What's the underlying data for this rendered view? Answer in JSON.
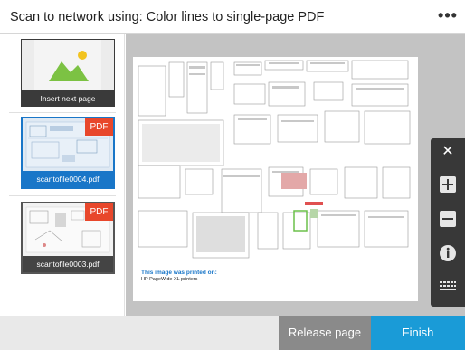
{
  "header": {
    "title": "Scan to network using: Color lines to single-page PDF",
    "more_icon": "more-dots-icon"
  },
  "sidebar": {
    "insert": {
      "label": "Insert next page",
      "icon": "image-placeholder-icon"
    },
    "files": [
      {
        "name": "scantofile0004.pdf",
        "badge": "PDF",
        "selected": true
      },
      {
        "name": "scantofile0003.pdf",
        "badge": "PDF",
        "selected": false
      }
    ]
  },
  "preview": {
    "note_title": "This image was printed on:",
    "note_sub": "HP PageWide XL printers"
  },
  "zoom_panel": {
    "buttons": [
      "close-icon",
      "zoom-in-icon",
      "zoom-out-icon",
      "info-icon",
      "keyboard-icon"
    ]
  },
  "footer": {
    "release_label": "Release page",
    "finish_label": "Finish"
  },
  "colors": {
    "accent": "#1a9bd7",
    "selected": "#1976c8",
    "pdf_badge": "#e8472b",
    "panel": "#383838"
  }
}
